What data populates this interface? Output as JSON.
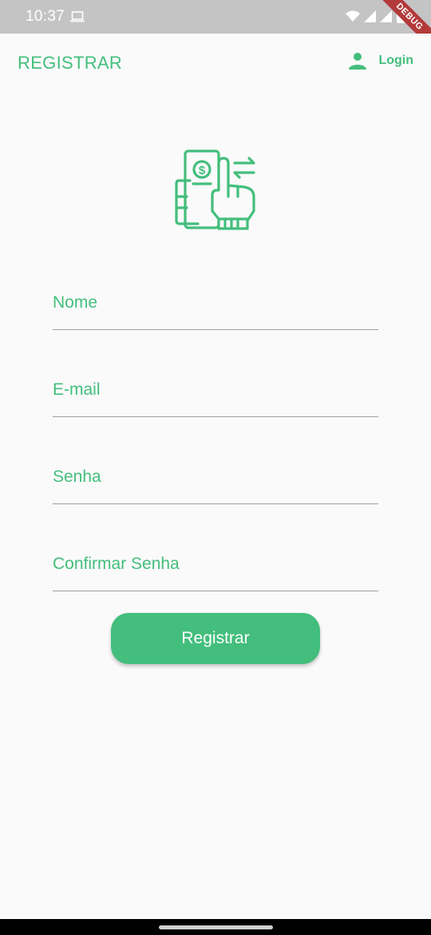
{
  "status_bar": {
    "time": "10:37",
    "icons": [
      "laptop-icon",
      "wifi-icon",
      "signal-icon",
      "signal-icon",
      "battery-icon"
    ],
    "debug_banner": "DEBUG"
  },
  "app_bar": {
    "title": "REGISTRAR",
    "login_label": "Login",
    "login_icon": "person-icon"
  },
  "illustration": {
    "icon": "payment-hand-dollar-icon"
  },
  "form": {
    "fields": [
      {
        "label": "Nome",
        "value": ""
      },
      {
        "label": "E-mail",
        "value": ""
      },
      {
        "label": "Senha",
        "value": ""
      },
      {
        "label": "Confirmar Senha",
        "value": ""
      }
    ],
    "submit_label": "Registrar"
  },
  "colors": {
    "accent": "#43be7c",
    "background": "#fafafa",
    "status_bar": "#c4c4c4",
    "debug_banner": "#b23a3a"
  }
}
